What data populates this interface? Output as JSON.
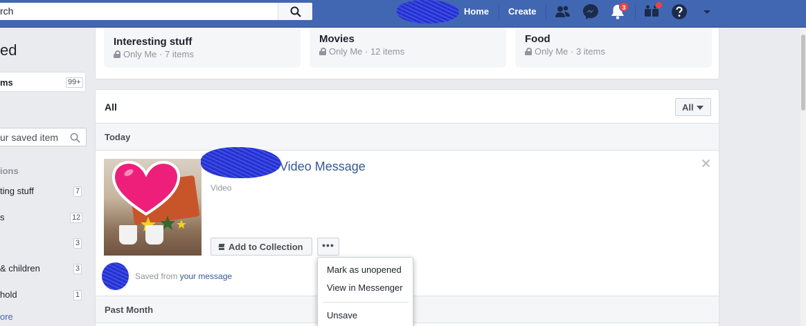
{
  "topbar": {
    "search_text": "rch",
    "nav": {
      "home": "Home",
      "create": "Create"
    },
    "notifications_count": "3",
    "icons": [
      "friends-icon",
      "messenger-icon",
      "notifications-icon",
      "friend-requests-icon",
      "help-icon",
      "account-menu-icon"
    ]
  },
  "sidebar": {
    "title": "ed",
    "items_label": "ms",
    "items_count": "99+",
    "search_placeholder": "ur saved item",
    "section_label": "ions",
    "collections": [
      {
        "name": "ting stuff",
        "count": "7"
      },
      {
        "name": "s",
        "count": "12"
      },
      {
        "name": "",
        "count": "3"
      },
      {
        "name": "& children",
        "count": "3"
      },
      {
        "name": "hold",
        "count": "1"
      }
    ],
    "see_more": "ore"
  },
  "collections_cards": [
    {
      "title": "Interesting stuff",
      "meta": "Only Me · 7 items"
    },
    {
      "title": "Movies",
      "meta": "Only Me · 12 items"
    },
    {
      "title": "Food",
      "meta": "Only Me · 3 items"
    }
  ],
  "main": {
    "title": "All",
    "filter_label": "All",
    "sections": {
      "today": "Today",
      "past_month": "Past Month"
    },
    "item": {
      "title": "Video Message",
      "type": "Video",
      "add_button": "Add to Collection",
      "more_button": "•••",
      "saved_from_prefix": "Saved from",
      "saved_from_link": "your message"
    },
    "menu": {
      "mark_unopened": "Mark as unopened",
      "view_messenger": "View in Messenger",
      "unsave": "Unsave"
    }
  },
  "colors": {
    "brand": "#4267b2",
    "link": "#365899",
    "badge": "#fa3e3e",
    "heart": "#ee1f7a"
  }
}
